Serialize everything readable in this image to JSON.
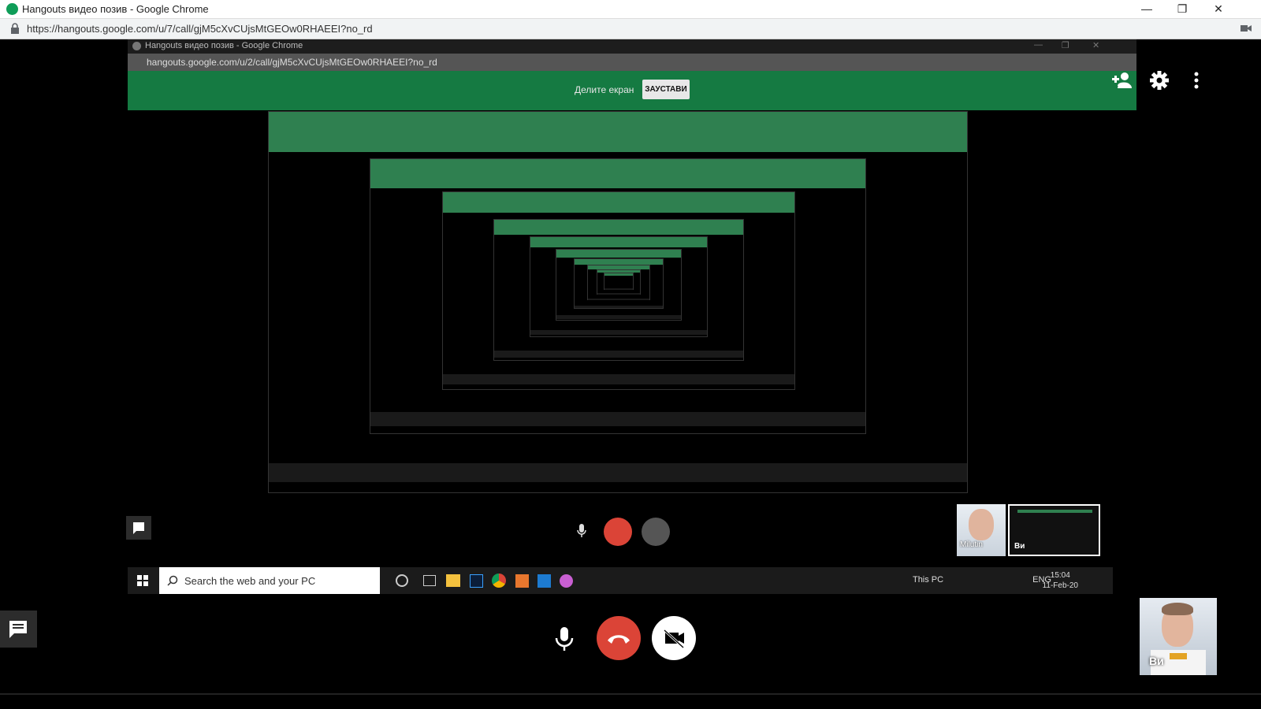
{
  "window": {
    "title": "Hangouts видео позив - Google Chrome",
    "url": "https://hangouts.google.com/u/7/call/gjM5cXvCUjsMtGEOw0RHAEEI?no_rd",
    "minimize": "—",
    "restore": "❐",
    "close": "✕"
  },
  "inner_window": {
    "title": "Hangouts видео позив - Google Chrome",
    "url": "hangouts.google.com/u/2/call/gjM5cXvCUjsMtGEOw0RHAEEI?no_rd",
    "share_text": "Делите екран",
    "stop_button": "ЗАУСТАВИ",
    "taskbar": {
      "search_placeholder": "Search the web and your PC",
      "tray_label": "This PC",
      "lang": "ENG",
      "time": "15:04",
      "date": "11-Feb-20"
    },
    "participant_name": "Milutin",
    "self_label": "Ви"
  },
  "call": {
    "self_label": "Ви",
    "colors": {
      "hangup": "#db4437",
      "banner": "#157a42",
      "accent": "#0f9d58"
    }
  },
  "icons": {
    "add_person": "add-person-icon",
    "settings": "gear-icon",
    "more": "more-vert-icon",
    "chat": "chat-icon",
    "mic": "mic-icon",
    "hangup": "hangup-icon",
    "video_off": "video-off-icon"
  }
}
